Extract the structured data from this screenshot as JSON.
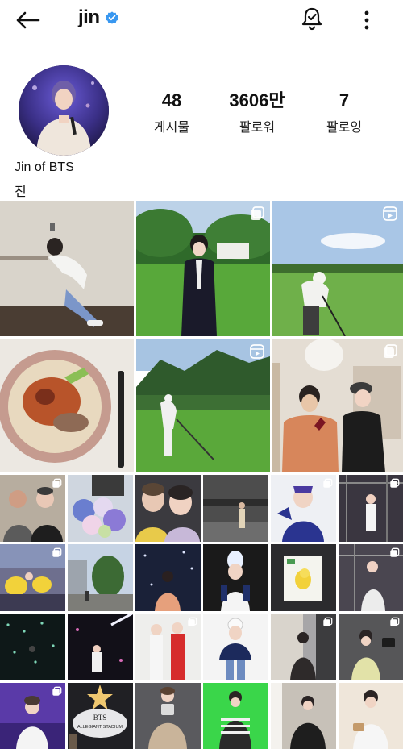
{
  "header": {
    "username": "jin",
    "verified": true,
    "icons": [
      "back-arrow-icon",
      "verified-badge-icon",
      "notification-bell-icon",
      "more-options-icon"
    ]
  },
  "profile": {
    "stats": [
      {
        "value": "48",
        "label": "게시물"
      },
      {
        "value": "3606만",
        "label": "팔로워"
      },
      {
        "value": "7",
        "label": "팔로잉"
      }
    ],
    "full_name": "Jin of BTS",
    "bio": "진"
  },
  "colors": {
    "verified_blue": "#3897f0",
    "text": "#111111",
    "background": "#ffffff"
  },
  "grid": {
    "large_rows": [
      {
        "tiles": [
          {
            "desc": "wall-pose",
            "badge": ""
          },
          {
            "desc": "suit-garden",
            "badge": "multi-image-icon"
          },
          {
            "desc": "golf-swing-course",
            "badge": "reels-icon"
          }
        ]
      },
      {
        "tiles": [
          {
            "desc": "noodle-bowl",
            "badge": ""
          },
          {
            "desc": "golf-mountain",
            "badge": "reels-icon"
          },
          {
            "desc": "wine-toast",
            "badge": "multi-image-icon"
          }
        ]
      }
    ],
    "small_rows": [
      {
        "tiles": [
          {
            "badge": "multi-image-icon"
          },
          {
            "badge": ""
          },
          {
            "badge": ""
          },
          {
            "badge": ""
          },
          {
            "badge": "multi-image-icon"
          },
          {
            "badge": "multi-image-icon"
          }
        ]
      },
      {
        "tiles": [
          {
            "badge": "multi-image-icon"
          },
          {
            "badge": ""
          },
          {
            "badge": ""
          },
          {
            "badge": ""
          },
          {
            "badge": ""
          },
          {
            "badge": "multi-image-icon"
          }
        ]
      },
      {
        "tiles": [
          {
            "badge": ""
          },
          {
            "badge": ""
          },
          {
            "badge": "multi-image-icon"
          },
          {
            "badge": ""
          },
          {
            "badge": "multi-image-icon"
          },
          {
            "badge": "multi-image-icon"
          }
        ]
      },
      {
        "tiles": [
          {
            "badge": "multi-image-icon"
          },
          {
            "badge": ""
          },
          {
            "badge": ""
          },
          {
            "badge": ""
          },
          {
            "badge": ""
          },
          {
            "badge": ""
          }
        ]
      }
    ],
    "tile_text": {
      "bts_sign": "BTS",
      "stadium_sign": "ALLEGIANT STADIUM"
    }
  }
}
